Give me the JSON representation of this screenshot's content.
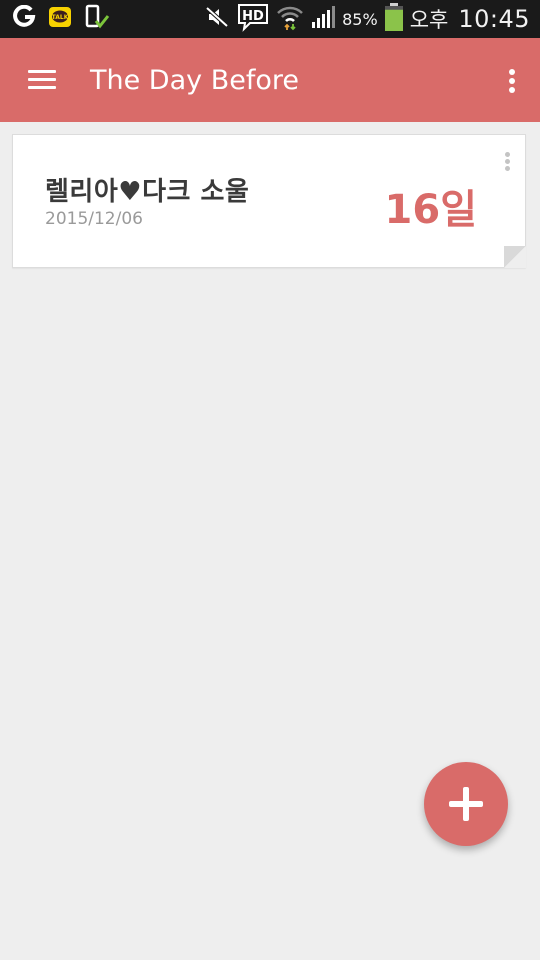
{
  "status_bar": {
    "left_icons": [
      "olleh-icon",
      "kakaotalk-icon",
      "download-complete-icon"
    ],
    "kakao_badge": "TALK",
    "right_icons": [
      "mute-icon",
      "hd-voice-icon",
      "wifi-icon",
      "signal-icon",
      "battery-icon"
    ],
    "hd_label": "HD",
    "battery_percent": "85%",
    "am_pm": "오후",
    "time": "10:45",
    "battery_level": 0.85,
    "battery_color": "#8bc34a"
  },
  "app_bar": {
    "title": "The Day Before",
    "color": "#d96b69"
  },
  "events": [
    {
      "title": "렐리아♥다크 소울",
      "date": "2015/12/06",
      "dday": "16일"
    }
  ],
  "fab": {
    "icon": "plus-icon",
    "color": "#d96b69"
  },
  "background_color": "#eeeeee"
}
